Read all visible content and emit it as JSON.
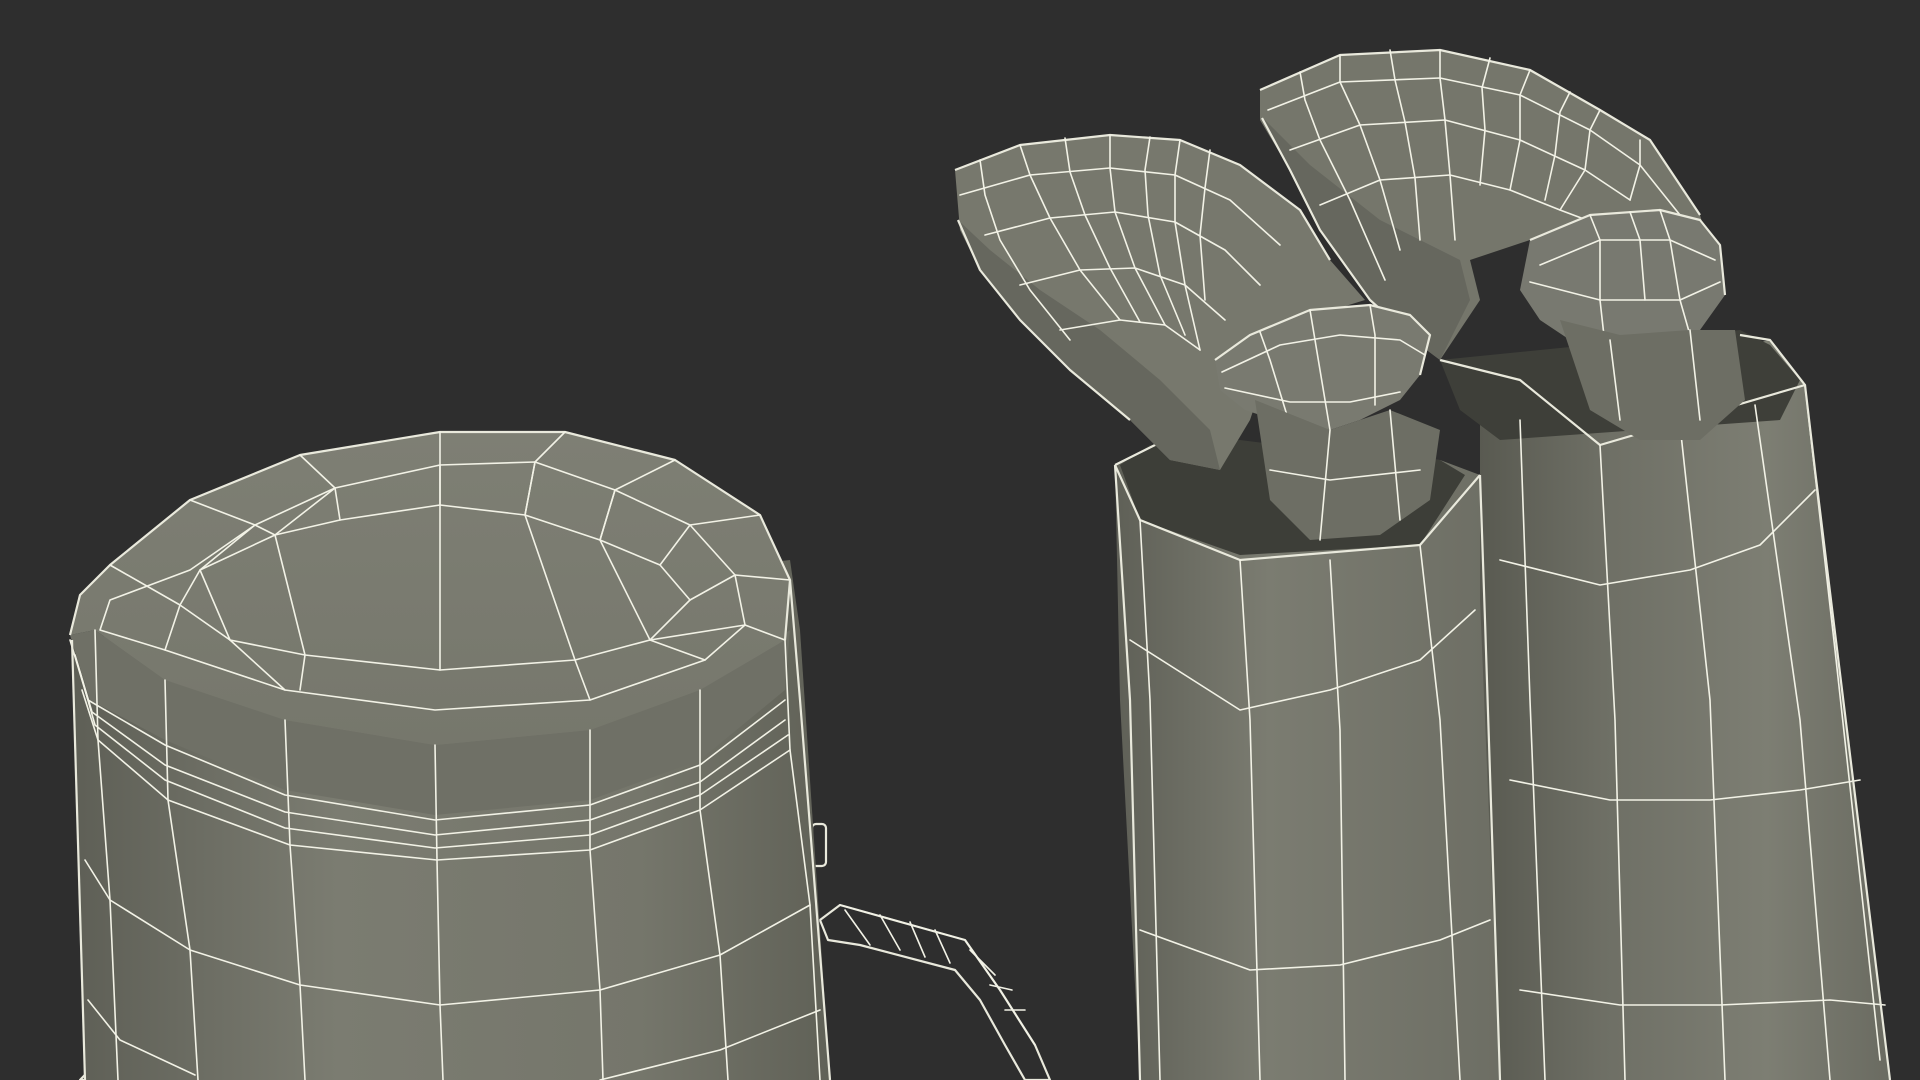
{
  "scene": {
    "background_color": "#2e2e2e",
    "surface_color": "#77786d",
    "surface_shadow_color": "#585950",
    "surface_light_color": "#8a8b80",
    "wire_color": "#f2f2e6",
    "objects": [
      "container-with-lid",
      "bottle-with-folding-handle-left",
      "bottle-with-folding-handle-right"
    ]
  }
}
